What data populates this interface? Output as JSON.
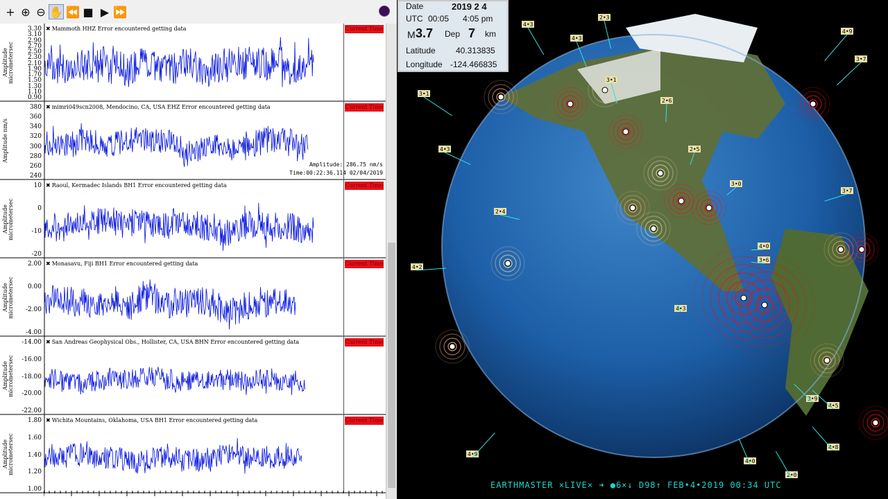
{
  "toolbar": {
    "items": [
      {
        "name": "add-icon",
        "glyph": "+"
      },
      {
        "name": "zoom-in-icon",
        "glyph": "⊕"
      },
      {
        "name": "zoom-out-icon",
        "glyph": "⊖"
      },
      {
        "name": "hand-icon",
        "glyph": "✋"
      },
      {
        "name": "rewind-icon",
        "glyph": "⏪"
      },
      {
        "name": "stop-icon",
        "glyph": "■"
      },
      {
        "name": "play-icon",
        "glyph": "▶"
      },
      {
        "name": "fast-forward-icon",
        "glyph": "⏩"
      }
    ]
  },
  "panels": [
    {
      "title": "Mammoth HHZ Error encountered getting data",
      "ylabel": "Amplitude micrometersec",
      "ylabel_short": "Amplitude\nmicrons/sec",
      "ticks": [
        "3.30",
        "3.10",
        "2.90",
        "2.70",
        "2.50",
        "2.30",
        "2.10",
        "1.90",
        "1.70",
        "1.50",
        "1.30",
        "1.10",
        "0.90"
      ],
      "current": "Current Time",
      "seed": 11,
      "amp": 0.85,
      "trace_end": 0.9
    },
    {
      "title": "mimri049scn2008, Mendocino, CA, USA EHZ Error encountered getting data",
      "ylabel": "Amplitude nm/s",
      "ticks": [
        "380",
        "360",
        "340",
        "320",
        "300",
        "280",
        "260",
        "240"
      ],
      "current": "Current Time",
      "seed": 23,
      "amp": 0.7,
      "trace_end": 0.88,
      "readout": {
        "amplitude": "Amplitude: 286.75 nm/s",
        "time": "Time:00:22:36.114 02/04/2019"
      }
    },
    {
      "title": "Raoul, Kermadec Islands BH1 Error encountered getting data",
      "ylabel": "Amplitude micrometersec",
      "ticks": [
        "10",
        "0",
        "-10",
        "-20"
      ],
      "current": "Current Time",
      "seed": 37,
      "amp": 0.75,
      "trace_end": 0.9
    },
    {
      "title": "Monasavu, Fiji BH1 Error encountered getting data",
      "ylabel": "Amplitude micrometersec",
      "ticks": [
        "2.00",
        "0.00",
        "-2.00",
        "-4.00"
      ],
      "current": "Current Time",
      "seed": 41,
      "amp": 0.8,
      "trace_end": 0.84
    },
    {
      "title": "San Andreas Geophysical Obs., Hollister, CA, USA BHN Error encountered getting data",
      "ylabel": "Amplitude micrometersec",
      "ticks": [
        "-14.00",
        "-16.00",
        "-18.00",
        "-20.00",
        "-22.00"
      ],
      "current": "Current Time",
      "seed": 53,
      "amp": 0.55,
      "trace_end": 0.87
    },
    {
      "title": "Wichita Mountains, Oklahoma, USA BH1 Error encountered getting data",
      "ylabel": "Amplitude micrometersec",
      "ticks": [
        "1.80",
        "1.60",
        "1.40",
        "1.20",
        "1.00"
      ],
      "current": "Current Time",
      "seed": 67,
      "amp": 0.6,
      "trace_end": 0.86
    }
  ],
  "info": {
    "date_label": "Date",
    "date_value": "2019  2  4",
    "utc_label": "UTC",
    "utc_value": "00:05",
    "local_time": "4:05 pm",
    "mag_label": "M",
    "mag_value": "3.7",
    "dep_label": "Dep",
    "dep_value": "7",
    "dep_unit": "km",
    "lat_label": "Latitude",
    "lat_value": "40.313835",
    "lon_label": "Longitude",
    "lon_value": "-124.466835"
  },
  "banner": "EARTHMASTER ×LIVE×  ➜  ●6×↓ D98↑ FEB•4•2019 00:34 UTC",
  "colors": {
    "trace": "#0010e0",
    "ocean": "#1d5fa8",
    "land": "#5f6f3a",
    "alert": "#e8101a",
    "leader": "#33e0e0"
  }
}
